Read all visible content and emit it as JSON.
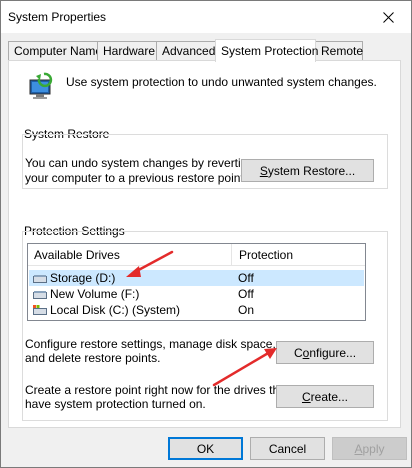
{
  "window": {
    "title": "System Properties"
  },
  "tabs": [
    {
      "label": "Computer Name"
    },
    {
      "label": "Hardware"
    },
    {
      "label": "Advanced"
    },
    {
      "label": "System Protection"
    },
    {
      "label": "Remote"
    }
  ],
  "active_tab": "System Protection",
  "intro": {
    "text": "Use system protection to undo unwanted system changes."
  },
  "system_restore": {
    "heading": "System Restore",
    "line1": "You can undo system changes by reverting",
    "line2": "your computer to a previous restore point.",
    "button_pre": "",
    "button_accel": "S",
    "button_post": "ystem Restore..."
  },
  "protection": {
    "heading": "Protection Settings",
    "columns": [
      "Available Drives",
      "Protection"
    ],
    "drives": [
      {
        "name": "Storage (D:)",
        "protection": "Off",
        "selected": true
      },
      {
        "name": "New Volume (F:)",
        "protection": "Off",
        "selected": false
      },
      {
        "name": "Local Disk (C:) (System)",
        "protection": "On",
        "selected": false
      }
    ],
    "configure_line1": "Configure restore settings, manage disk space,",
    "configure_line2": "and delete restore points.",
    "configure_pre": "C",
    "configure_accel": "o",
    "configure_post": "nfigure...",
    "create_line1": "Create a restore point right now for the drives that",
    "create_line2": "have system protection turned on.",
    "create_pre": "",
    "create_accel": "C",
    "create_post": "reate..."
  },
  "footer": {
    "ok": "OK",
    "cancel": "Cancel",
    "apply_accel": "A",
    "apply_post": "pply"
  },
  "colors": {
    "selection": "#cce8ff",
    "annotation_arrow": "#e32b2b",
    "focus_border": "#0078d7"
  }
}
